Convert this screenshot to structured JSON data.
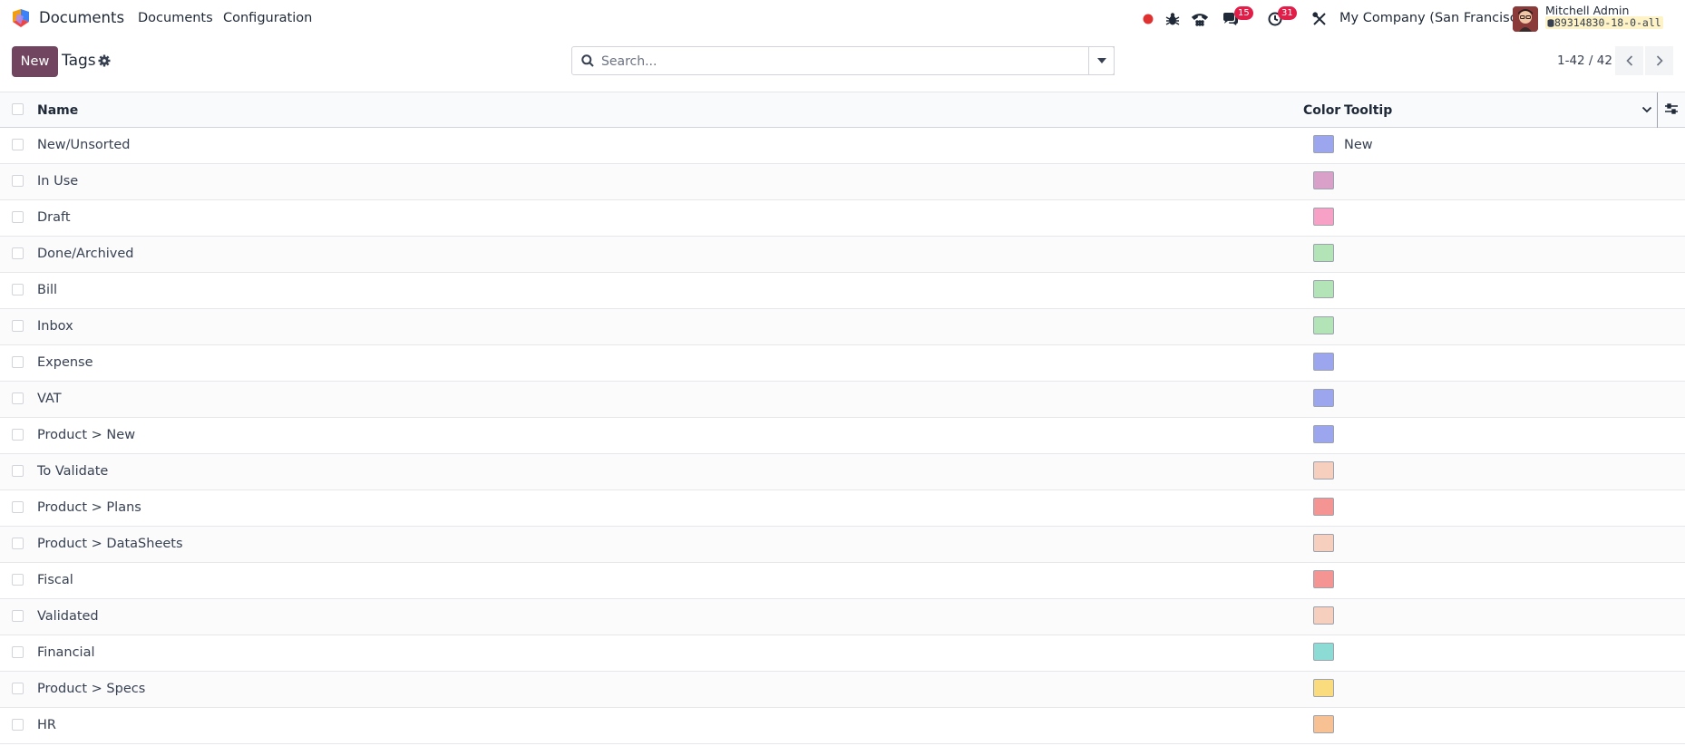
{
  "navbar": {
    "app_title": "Documents",
    "menu": [
      "Documents",
      "Configuration"
    ],
    "messages_count": "15",
    "activities_count": "31",
    "company": "My Company (San Francisco)",
    "user_name": "Mitchell Admin",
    "database": "89314830-18-0-all"
  },
  "control_panel": {
    "new_label": "New",
    "title": "Tags",
    "search_placeholder": "Search...",
    "pager": "1-42 / 42"
  },
  "table": {
    "columns": {
      "name": "Name",
      "color": "Color",
      "tooltip": "Tooltip"
    },
    "rows": [
      {
        "name": "New/Unsorted",
        "color": "#9ba6ee",
        "tooltip": "New"
      },
      {
        "name": "In Use",
        "color": "#d9a1c9",
        "tooltip": ""
      },
      {
        "name": "Draft",
        "color": "#f7a1c7",
        "tooltip": ""
      },
      {
        "name": "Done/Archived",
        "color": "#b2e4b8",
        "tooltip": ""
      },
      {
        "name": "Bill",
        "color": "#b2e4b8",
        "tooltip": ""
      },
      {
        "name": "Inbox",
        "color": "#b2e4b8",
        "tooltip": ""
      },
      {
        "name": "Expense",
        "color": "#9ba6ee",
        "tooltip": ""
      },
      {
        "name": "VAT",
        "color": "#9ba6ee",
        "tooltip": ""
      },
      {
        "name": "Product > New",
        "color": "#9ba6ee",
        "tooltip": ""
      },
      {
        "name": "To Validate",
        "color": "#f6cfbf",
        "tooltip": ""
      },
      {
        "name": "Product > Plans",
        "color": "#f49594",
        "tooltip": ""
      },
      {
        "name": "Product > DataSheets",
        "color": "#f6cfbf",
        "tooltip": ""
      },
      {
        "name": "Fiscal",
        "color": "#f49594",
        "tooltip": ""
      },
      {
        "name": "Validated",
        "color": "#f6cfbf",
        "tooltip": ""
      },
      {
        "name": "Financial",
        "color": "#8ddbd5",
        "tooltip": ""
      },
      {
        "name": "Product > Specs",
        "color": "#fadc7f",
        "tooltip": ""
      },
      {
        "name": "HR",
        "color": "#f7c193",
        "tooltip": ""
      }
    ]
  },
  "colors": {
    "brand_primary": "#71445f",
    "badge": "#e11d48",
    "recording_dot": "#e03131"
  }
}
